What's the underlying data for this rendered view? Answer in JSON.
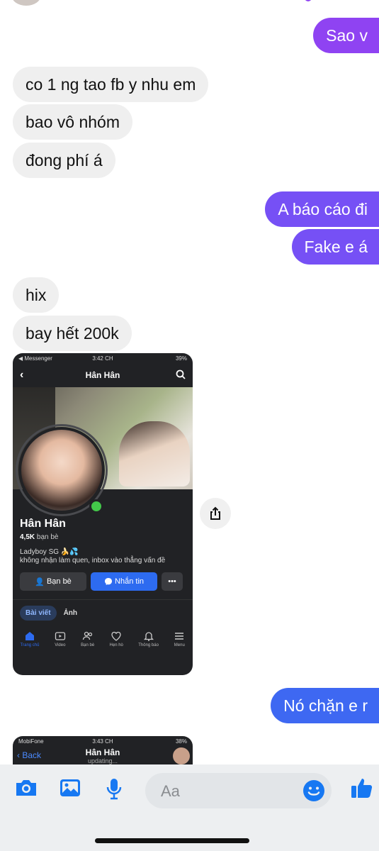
{
  "messages": {
    "m1": "Sao v",
    "m2": "co 1 ng tao fb y nhu em",
    "m3": "bao vô nhóm",
    "m4": "đong phí á",
    "m5": "A báo cáo đi",
    "m6": "Fake e á",
    "m7": "hix",
    "m8": "bay hết 200k",
    "m9": "Nó chặn e r"
  },
  "screenshot1": {
    "status_left": "◀ Messenger",
    "status_time": "3:42 CH",
    "status_right": "39%",
    "title": "Hân Hân",
    "name": "Hân Hân",
    "friends_count": "4,5K",
    "friends_label": "bạn bè",
    "bio_line1": "Ladyboy SG 🍌💦",
    "bio_line2": "không nhận làm quen, inbox vào thẳng vấn đề",
    "btn_friends": "Bạn bè",
    "btn_message": "Nhắn tin",
    "btn_more": "•••",
    "tab_posts": "Bài viết",
    "tab_photos": "Ảnh",
    "nav": [
      "Trang chủ",
      "Video",
      "Bạn bè",
      "Hẹn hò",
      "Thông báo",
      "Menu"
    ]
  },
  "screenshot2": {
    "status_left": "MobiFone",
    "status_time": "3:43 CH",
    "status_right": "38%",
    "back_label": "Back",
    "title": "Hân Hân",
    "subtitle": "updating..."
  },
  "composer": {
    "placeholder": "Aa"
  },
  "colors": {
    "purple": "#8f43f2",
    "violet": "#7650f5",
    "blue": "#3e68f2",
    "incoming": "#efefef",
    "messenger_blue": "#1778f2"
  }
}
